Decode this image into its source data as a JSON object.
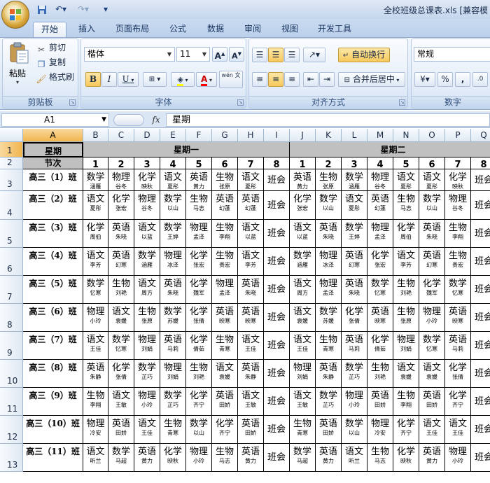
{
  "window": {
    "title": "全校班级总课表.xls  [兼容模"
  },
  "tabs": [
    {
      "label": "开始",
      "active": true
    },
    {
      "label": "插入",
      "active": false
    },
    {
      "label": "页面布局",
      "active": false
    },
    {
      "label": "公式",
      "active": false
    },
    {
      "label": "数据",
      "active": false
    },
    {
      "label": "审阅",
      "active": false
    },
    {
      "label": "视图",
      "active": false
    },
    {
      "label": "开发工具",
      "active": false
    }
  ],
  "clipboard": {
    "group": "剪贴板",
    "paste": "粘贴",
    "cut": "剪切",
    "copy": "复制",
    "format_painter": "格式刷"
  },
  "font": {
    "group": "字体",
    "name": "楷体",
    "size": "11",
    "grow": "A",
    "shrink": "A",
    "bold": "B",
    "italic": "I",
    "underline": "U",
    "color_letter": "A",
    "phonetic": "wén 文"
  },
  "alignment": {
    "group": "对齐方式",
    "wrap": "自动换行",
    "merge": "合并后居中"
  },
  "number": {
    "group": "数字",
    "format": "常规",
    "percent": "%",
    "comma": ","
  },
  "formula": {
    "cell_ref": "A1",
    "fx": "fx",
    "content": "星期"
  },
  "columns": [
    "A",
    "B",
    "C",
    "D",
    "E",
    "F",
    "G",
    "H",
    "I",
    "J",
    "K",
    "L",
    "M",
    "N",
    "O",
    "P",
    "Q"
  ],
  "rows": [
    "1",
    "2",
    "3",
    "4",
    "5",
    "6",
    "7",
    "8",
    "9",
    "10",
    "11",
    "12",
    "13"
  ],
  "table": {
    "h_week": "星期",
    "h_period": "节次",
    "days": [
      "星期一",
      "星期二"
    ],
    "periods": [
      "1",
      "2",
      "3",
      "4",
      "5",
      "6",
      "7",
      "8",
      "1",
      "2",
      "3",
      "4",
      "5",
      "6",
      "7",
      "8"
    ],
    "class_meeting": "班会",
    "classes": [
      {
        "name": "高三（1）班",
        "mon": [
          [
            "数学",
            "涵雁"
          ],
          [
            "物理",
            "谷冬"
          ],
          [
            "化学",
            "映秋"
          ],
          [
            "语文",
            "夏彤"
          ],
          [
            "英语",
            "黄力"
          ],
          [
            "生物",
            "张原"
          ],
          [
            "语文",
            "夏彤"
          ]
        ],
        "tue": [
          [
            "英语",
            "黄力"
          ],
          [
            "生物",
            "张原"
          ],
          [
            "数学",
            "涵雁"
          ],
          [
            "物理",
            "谷冬"
          ],
          [
            "语文",
            "夏彤"
          ],
          [
            "语文",
            "夏彤"
          ],
          [
            "化学",
            "映秋"
          ]
        ]
      },
      {
        "name": "高三（2）班",
        "mon": [
          [
            "语文",
            "夏彤"
          ],
          [
            "化学",
            "张宏"
          ],
          [
            "物理",
            "谷冬"
          ],
          [
            "数学",
            "以山"
          ],
          [
            "生物",
            "马志"
          ],
          [
            "英语",
            "幻蓬"
          ],
          [
            "英语",
            "幻蓬"
          ]
        ],
        "tue": [
          [
            "化学",
            "张宏"
          ],
          [
            "数学",
            "以山"
          ],
          [
            "语文",
            "夏彤"
          ],
          [
            "英语",
            "幻蓬"
          ],
          [
            "生物",
            "马志"
          ],
          [
            "数学",
            "以山"
          ],
          [
            "物理",
            "谷冬"
          ]
        ]
      },
      {
        "name": "高三（3）班",
        "mon": [
          [
            "化学",
            "周伯"
          ],
          [
            "英语",
            "朱晓"
          ],
          [
            "语文",
            "以蓝"
          ],
          [
            "数学",
            "王婷"
          ],
          [
            "物理",
            "孟泽"
          ],
          [
            "生物",
            "李翔"
          ],
          [
            "语文",
            "以蓝"
          ]
        ],
        "tue": [
          [
            "语文",
            "以蓝"
          ],
          [
            "英语",
            "朱晓"
          ],
          [
            "数学",
            "王婷"
          ],
          [
            "物理",
            "孟泽"
          ],
          [
            "化学",
            "周伯"
          ],
          [
            "英语",
            "朱晓"
          ],
          [
            "生物",
            "李翔"
          ]
        ]
      },
      {
        "name": "高三（4）班",
        "mon": [
          [
            "语文",
            "李芳"
          ],
          [
            "英语",
            "幻寒"
          ],
          [
            "数学",
            "涵雁"
          ],
          [
            "物理",
            "冰泽"
          ],
          [
            "化学",
            "张宏"
          ],
          [
            "生物",
            "贵宏"
          ],
          [
            "语文",
            "李芳"
          ]
        ],
        "tue": [
          [
            "数学",
            "涵雁"
          ],
          [
            "物理",
            "冰泽"
          ],
          [
            "英语",
            "幻寒"
          ],
          [
            "化学",
            "张宏"
          ],
          [
            "语文",
            "李芳"
          ],
          [
            "英语",
            "幻寒"
          ],
          [
            "生物",
            "贵宏"
          ]
        ]
      },
      {
        "name": "高三（5）班",
        "mon": [
          [
            "数学",
            "忆寒"
          ],
          [
            "生物",
            "刘艳"
          ],
          [
            "语文",
            "周方"
          ],
          [
            "英语",
            "朱晓"
          ],
          [
            "化学",
            "魏军"
          ],
          [
            "物理",
            "孟泽"
          ],
          [
            "英语",
            "朱晓"
          ]
        ],
        "tue": [
          [
            "语文",
            "周方"
          ],
          [
            "物理",
            "孟泽"
          ],
          [
            "英语",
            "朱晓"
          ],
          [
            "数学",
            "忆寒"
          ],
          [
            "生物",
            "刘艳"
          ],
          [
            "化学",
            "魏军"
          ],
          [
            "数学",
            "忆寒"
          ]
        ]
      },
      {
        "name": "高三（6）班",
        "mon": [
          [
            "物理",
            "小玲"
          ],
          [
            "语文",
            "袁媛"
          ],
          [
            "生物",
            "张原"
          ],
          [
            "数学",
            "苏媛"
          ],
          [
            "化学",
            "张倩"
          ],
          [
            "英语",
            "映寒"
          ],
          [
            "英语",
            "映寒"
          ]
        ],
        "tue": [
          [
            "语文",
            "袁媛"
          ],
          [
            "数学",
            "苏媛"
          ],
          [
            "化学",
            "张倩"
          ],
          [
            "英语",
            "映寒"
          ],
          [
            "生物",
            "张原"
          ],
          [
            "物理",
            "小玲"
          ],
          [
            "英语",
            "映寒"
          ]
        ]
      },
      {
        "name": "高三（7）班",
        "mon": [
          [
            "语文",
            "王佳"
          ],
          [
            "数学",
            "忆寒"
          ],
          [
            "物理",
            "刘娟"
          ],
          [
            "英语",
            "马莉"
          ],
          [
            "化学",
            "倩茹"
          ],
          [
            "生物",
            "青寒"
          ],
          [
            "语文",
            "王佳"
          ]
        ],
        "tue": [
          [
            "语文",
            "王佳"
          ],
          [
            "生物",
            "青寒"
          ],
          [
            "英语",
            "马莉"
          ],
          [
            "化学",
            "倩茹"
          ],
          [
            "物理",
            "刘娟"
          ],
          [
            "数学",
            "忆寒"
          ],
          [
            "英语",
            "马莉"
          ]
        ]
      },
      {
        "name": "高三（8）班",
        "mon": [
          [
            "英语",
            "朱静"
          ],
          [
            "化学",
            "张倩"
          ],
          [
            "数学",
            "芷巧"
          ],
          [
            "物理",
            "刘娟"
          ],
          [
            "生物",
            "刘艳"
          ],
          [
            "语文",
            "袁媛"
          ],
          [
            "英语",
            "朱静"
          ]
        ],
        "tue": [
          [
            "物理",
            "刘娟"
          ],
          [
            "英语",
            "朱静"
          ],
          [
            "数学",
            "芷巧"
          ],
          [
            "生物",
            "刘艳"
          ],
          [
            "语文",
            "袁媛"
          ],
          [
            "语文",
            "袁媛"
          ],
          [
            "化学",
            "张倩"
          ]
        ]
      },
      {
        "name": "高三（9）班",
        "mon": [
          [
            "生物",
            "李翔"
          ],
          [
            "语文",
            "王敏"
          ],
          [
            "物理",
            "小玲"
          ],
          [
            "数学",
            "芷巧"
          ],
          [
            "化学",
            "齐宁"
          ],
          [
            "英语",
            "田娇"
          ],
          [
            "语文",
            "王敏"
          ]
        ],
        "tue": [
          [
            "语文",
            "王敏"
          ],
          [
            "数学",
            "芷巧"
          ],
          [
            "物理",
            "小玲"
          ],
          [
            "英语",
            "田娇"
          ],
          [
            "生物",
            "李翔"
          ],
          [
            "英语",
            "田娇"
          ],
          [
            "化学",
            "齐宁"
          ]
        ]
      },
      {
        "name": "高三（10）班",
        "mon": [
          [
            "物理",
            "冷安"
          ],
          [
            "英语",
            "田娇"
          ],
          [
            "语文",
            "王佳"
          ],
          [
            "生物",
            "青寒"
          ],
          [
            "数学",
            "以山"
          ],
          [
            "化学",
            "齐宁"
          ],
          [
            "英语",
            "田娇"
          ]
        ],
        "tue": [
          [
            "生物",
            "青寒"
          ],
          [
            "英语",
            "田娇"
          ],
          [
            "数学",
            "以山"
          ],
          [
            "物理",
            "冷安"
          ],
          [
            "化学",
            "齐宁"
          ],
          [
            "语文",
            "王佳"
          ],
          [
            "语文",
            "王佳"
          ]
        ]
      },
      {
        "name": "高三（11）班",
        "mon": [
          [
            "语文",
            "听兰"
          ],
          [
            "数学",
            "马超"
          ],
          [
            "英语",
            "黄力"
          ],
          [
            "化学",
            "映秋"
          ],
          [
            "物理",
            "小玲"
          ],
          [
            "生物",
            "马志"
          ],
          [
            "英语",
            "黄力"
          ]
        ],
        "tue": [
          [
            "数学",
            "马超"
          ],
          [
            "英语",
            "黄力"
          ],
          [
            "语文",
            "听兰"
          ],
          [
            "生物",
            "马志"
          ],
          [
            "化学",
            "映秋"
          ],
          [
            "英语",
            "黄力"
          ],
          [
            "物理",
            "小玲"
          ]
        ]
      }
    ]
  }
}
